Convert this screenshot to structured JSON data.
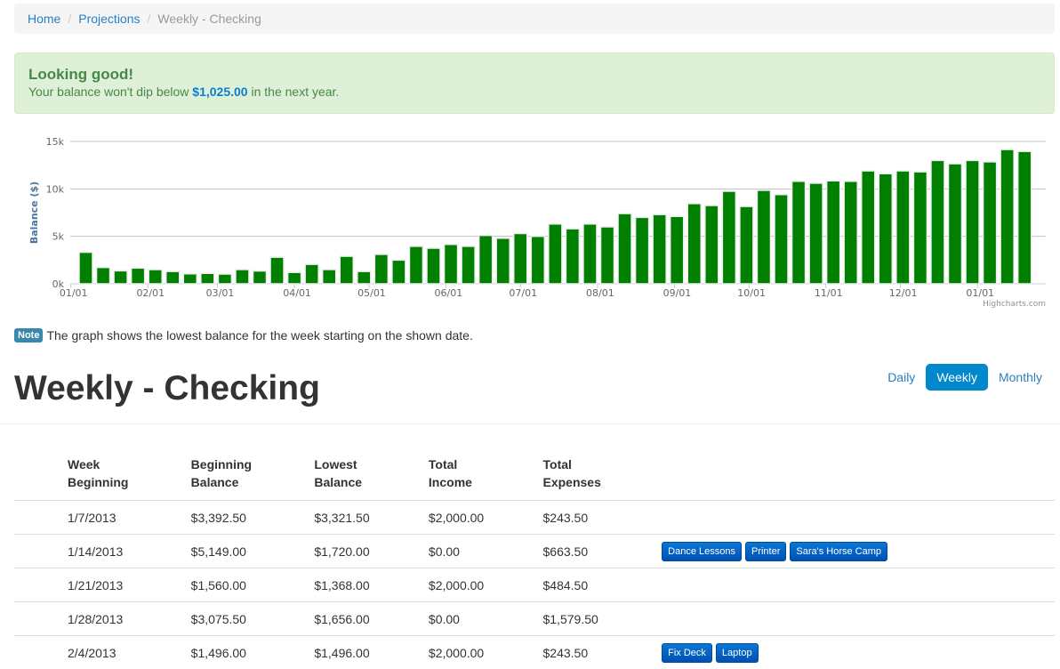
{
  "breadcrumb": {
    "items": [
      {
        "label": "Home"
      },
      {
        "label": "Projections"
      }
    ],
    "separator": "/",
    "current": "Weekly - Checking"
  },
  "alert": {
    "title": "Looking good!",
    "text_before": "Your balance won't dip below ",
    "amount": "$1,025.00",
    "text_after": " in the next year."
  },
  "note": {
    "badge": "Note",
    "text": "The graph shows the lowest balance for the week starting on the shown date."
  },
  "page_title": "Weekly - Checking",
  "view_pills": [
    {
      "label": "Daily",
      "active": false
    },
    {
      "label": "Weekly",
      "active": true
    },
    {
      "label": "Monthly",
      "active": false
    }
  ],
  "table": {
    "headers": [
      [
        "Week",
        "Beginning"
      ],
      [
        "Beginning",
        "Balance"
      ],
      [
        "Lowest",
        "Balance"
      ],
      [
        "Total",
        "Income"
      ],
      [
        "Total",
        "Expenses"
      ]
    ],
    "rows": [
      {
        "week": "1/7/2013",
        "beginning": "$3,392.50",
        "lowest": "$3,321.50",
        "income": "$2,000.00",
        "expenses": "$243.50",
        "tags": []
      },
      {
        "week": "1/14/2013",
        "beginning": "$5,149.00",
        "lowest": "$1,720.00",
        "income": "$0.00",
        "expenses": "$663.50",
        "tags": [
          "Dance Lessons",
          "Printer",
          "Sara's Horse Camp"
        ]
      },
      {
        "week": "1/21/2013",
        "beginning": "$1,560.00",
        "lowest": "$1,368.00",
        "income": "$2,000.00",
        "expenses": "$484.50",
        "tags": []
      },
      {
        "week": "1/28/2013",
        "beginning": "$3,075.50",
        "lowest": "$1,656.00",
        "income": "$0.00",
        "expenses": "$1,579.50",
        "tags": []
      },
      {
        "week": "2/4/2013",
        "beginning": "$1,496.00",
        "lowest": "$1,496.00",
        "income": "$2,000.00",
        "expenses": "$243.50",
        "tags": [
          "Fix Deck",
          "Laptop"
        ]
      }
    ]
  },
  "chart_data": {
    "type": "bar",
    "title": "",
    "xlabel": "",
    "ylabel": "Balance ($)",
    "ylim": [
      0,
      15000
    ],
    "yticks": [
      0,
      5000,
      10000,
      15000
    ],
    "ytick_labels": [
      "0k",
      "5k",
      "10k",
      "15k"
    ],
    "grid": true,
    "legend": "none",
    "credits": "Highcharts.com",
    "bar_color": "#007f00",
    "x_start_week_offset_days": 6,
    "xtick_labels": [
      {
        "label": "01/01",
        "week_index": -0.86
      },
      {
        "label": "02/01",
        "week_index": 3.57
      },
      {
        "label": "03/01",
        "week_index": 7.57
      },
      {
        "label": "04/01",
        "week_index": 12.0
      },
      {
        "label": "05/01",
        "week_index": 16.29
      },
      {
        "label": "06/01",
        "week_index": 20.71
      },
      {
        "label": "07/01",
        "week_index": 25.0
      },
      {
        "label": "08/01",
        "week_index": 29.43
      },
      {
        "label": "09/01",
        "week_index": 33.86
      },
      {
        "label": "10/01",
        "week_index": 38.14
      },
      {
        "label": "11/01",
        "week_index": 42.57
      },
      {
        "label": "12/01",
        "week_index": 46.86
      },
      {
        "label": "01/01",
        "week_index": 51.29
      }
    ],
    "values": [
      3321.5,
      1720,
      1368,
      1656,
      1496,
      1300,
      1050,
      1100,
      1025,
      1500,
      1350,
      2800,
      1200,
      2050,
      1500,
      2900,
      1300,
      3100,
      2500,
      3950,
      3750,
      4150,
      3950,
      5100,
      4800,
      5300,
      5000,
      6300,
      5800,
      6300,
      6000,
      7400,
      7000,
      7300,
      7100,
      8450,
      8250,
      9750,
      8150,
      9850,
      9400,
      10800,
      10600,
      10850,
      10800,
      11900,
      11600,
      11900,
      11800,
      13000,
      12650,
      13000,
      12850,
      14150,
      13950
    ]
  }
}
